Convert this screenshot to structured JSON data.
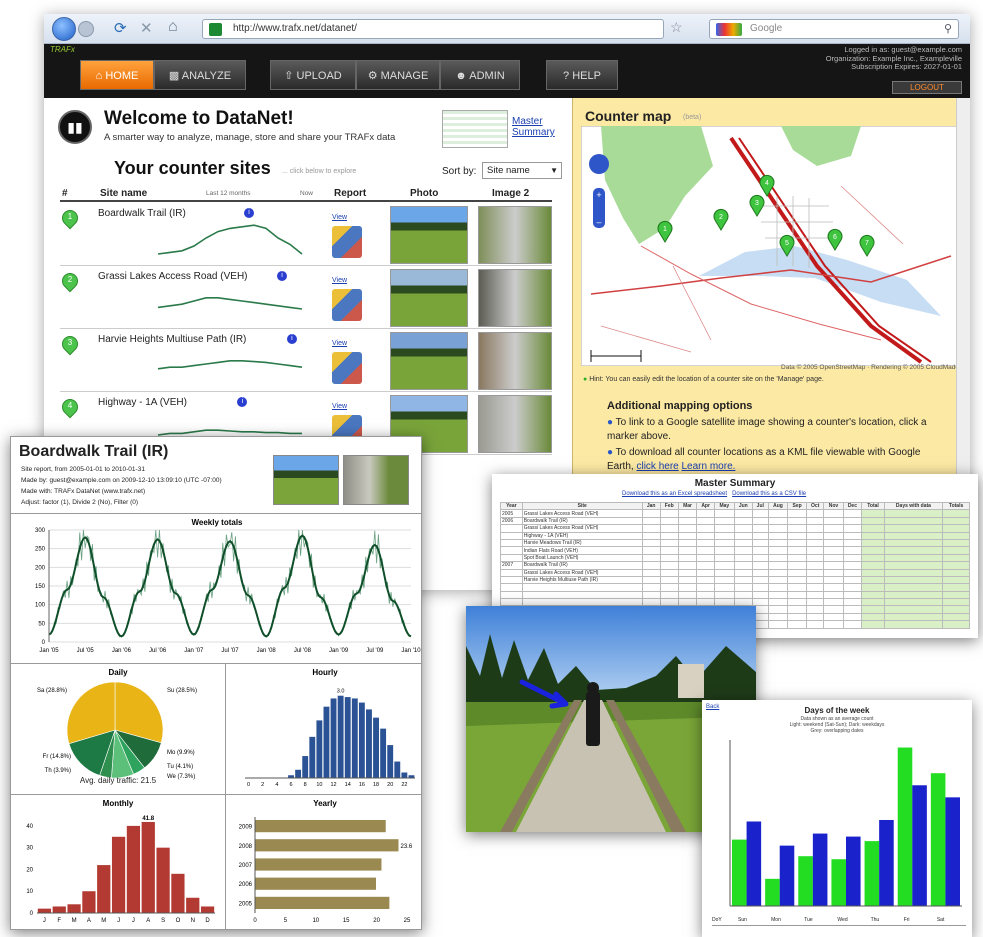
{
  "browser": {
    "url": "http://www.trafx.net/datanet/",
    "search_placeholder": "Google",
    "tab": "TRAFx"
  },
  "nav": {
    "home": "HOME",
    "analyze": "ANALYZE",
    "upload": "UPLOAD",
    "manage": "MANAGE",
    "admin": "ADMIN",
    "help": "HELP"
  },
  "account": {
    "logged_in": "Logged in as: guest@example.com",
    "organization": "Organization: Example Inc., Exampleville",
    "expires": "Subscription Expires: 2027-01-01",
    "logout": "LOGOUT"
  },
  "welcome": {
    "title": "Welcome to DataNet!",
    "subtitle": "A smarter way to analyze, manage, store and share your TRAFx data",
    "master_summary_link": "Master Summary"
  },
  "sites": {
    "title": "Your counter sites",
    "hint": "... click below to explore",
    "sort_label": "Sort by:",
    "sort_value": "Site name",
    "headers": {
      "num": "#",
      "name": "Site name",
      "last12": "Last 12 months",
      "now": "Now",
      "report": "Report",
      "photo": "Photo",
      "image2": "Image 2"
    },
    "view_label": "View",
    "rows": [
      {
        "num": "1",
        "name": "Boardwalk Trail (IR)"
      },
      {
        "num": "2",
        "name": "Grassi Lakes Access Road (VEH)"
      },
      {
        "num": "3",
        "name": "Harvie Heights Multiuse Path (IR)"
      },
      {
        "num": "4",
        "name": "Highway - 1A (VEH)"
      }
    ]
  },
  "map": {
    "title": "Counter map",
    "beta": "(beta)",
    "attribution": "Data © 2005 OpenStreetMap · Rendering © 2005 CloudMade",
    "hint": "Hint: You can easily edit the location of a counter site on the 'Manage' page.",
    "markers": [
      "1",
      "2",
      "3",
      "4",
      "5",
      "6",
      "7"
    ],
    "options_title": "Additional mapping options",
    "option1": "To link to a Google satellite image showing a counter's location, click a marker above.",
    "option2": "To download all counter locations as a KML file viewable with Google Earth,",
    "click_here": "click here",
    "learn_more": "Learn more."
  },
  "report": {
    "title": "Boardwalk Trail (IR)",
    "line1": "Site report, from 2005-01-01 to 2010-01-31",
    "line2": "Made by: guest@example.com on 2009-12-10 13:09:10 (UTC -07:00)",
    "line3": "Made with: TRAFx DataNet (www.trafx.net)",
    "line4": "Adjust: factor (1), Divide 2 (No), Filter (0)",
    "avg_daily": "Avg. daily traffic: 21.5"
  },
  "master": {
    "title": "Master Summary",
    "link1": "Download this as an Excel spreadsheet",
    "link2": "Download this as a CSV file",
    "headers": [
      "Year",
      "Site",
      "Jan",
      "Feb",
      "Mar",
      "Apr",
      "May",
      "Jun",
      "Jul",
      "Aug",
      "Sep",
      "Oct",
      "Nov",
      "Dec",
      "Total",
      "Days with data",
      "Totals"
    ],
    "years": [
      "2005",
      "2006",
      "2007"
    ],
    "sites": [
      "Grassi Lakes Access Road (VEH)",
      "Boardwalk Trail (IR)",
      "Grassi Lakes Access Road (VEH)",
      "Highway - 1A (VEH)",
      "Harvie Meadows Trail (IR)",
      "Indian Flats Road (VEH)",
      "Spot Boat Launch (VEH)",
      "Boardwalk Trail (IR)",
      "Grassi Lakes Access Road (VEH)",
      "Harvie Heights Multiuse Path (IR)"
    ]
  },
  "dow": {
    "title": "Days of the week",
    "back": "Back",
    "subtitle1": "Data shown as an average count",
    "subtitle2": "Light: weekend (Sat-Sun); Dark: weekdays",
    "subtitle3": "Grey: overlapping dates",
    "header": [
      "DoY",
      "Sun",
      "Mon",
      "Tue",
      "Wed",
      "Thu",
      "Fri",
      "Sat"
    ]
  },
  "chart_data": [
    {
      "type": "line",
      "title": "Weekly totals",
      "xlabel": "",
      "ylabel": "",
      "ylim": [
        0,
        300
      ],
      "x_ticks": [
        "Jan '05",
        "Jul '05",
        "Jan '06",
        "Jul '06",
        "Jan '07",
        "Jul '07",
        "Jan '08",
        "Jul '08",
        "Jan '09",
        "Jul '09",
        "Jan '10"
      ],
      "y_ticks": [
        0,
        50,
        100,
        150,
        200,
        250,
        300
      ],
      "series": [
        {
          "x": [
            "2005-01",
            "2005-04",
            "2005-07",
            "2005-10",
            "2006-01",
            "2006-04",
            "2006-07",
            "2006-10",
            "2007-01",
            "2007-04",
            "2007-07",
            "2007-10",
            "2008-01",
            "2008-04",
            "2008-07",
            "2008-10",
            "2009-01",
            "2009-04",
            "2009-07",
            "2009-10",
            "2010-01"
          ],
          "values": [
            20,
            140,
            280,
            120,
            15,
            135,
            275,
            130,
            20,
            140,
            270,
            125,
            15,
            145,
            285,
            120,
            20,
            130,
            260,
            110,
            15
          ]
        }
      ]
    },
    {
      "type": "pie",
      "title": "Daily",
      "slices": [
        {
          "label": "Su (28.5%)",
          "value": 28.5
        },
        {
          "label": "Mo (9.9%)",
          "value": 9.9
        },
        {
          "label": "Tu (4.1%)",
          "value": 4.1
        },
        {
          "label": "We (7.3%)",
          "value": 7.3
        },
        {
          "label": "Th (3.9%)",
          "value": 3.9
        },
        {
          "label": "Fr (14.8%)",
          "value": 14.8
        },
        {
          "label": "Sa (28.8%)",
          "value": 28.8
        }
      ],
      "colors": [
        "#e8b416",
        "#1f6b3a",
        "#2ea35d",
        "#5cc07a",
        "#2f8f4f",
        "#1e7a44",
        "#e8b416"
      ]
    },
    {
      "type": "bar",
      "title": "Hourly",
      "categories": [
        "0",
        "1",
        "2",
        "3",
        "4",
        "5",
        "6",
        "7",
        "8",
        "9",
        "10",
        "11",
        "12",
        "13",
        "14",
        "15",
        "16",
        "17",
        "18",
        "19",
        "20",
        "21",
        "22",
        "23"
      ],
      "values": [
        0,
        0,
        0,
        0,
        0,
        0,
        0.1,
        0.3,
        0.8,
        1.5,
        2.1,
        2.6,
        2.9,
        3.0,
        2.95,
        2.9,
        2.75,
        2.5,
        2.2,
        1.8,
        1.2,
        0.6,
        0.2,
        0.1
      ],
      "ylim": [
        0,
        3.5
      ],
      "peak_label": "3.0",
      "x_ticks": [
        "0",
        "2",
        "4",
        "6",
        "8",
        "10",
        "12",
        "14",
        "16",
        "18",
        "20",
        "22"
      ]
    },
    {
      "type": "bar",
      "title": "Monthly",
      "categories": [
        "J",
        "F",
        "M",
        "A",
        "M",
        "J",
        "J",
        "A",
        "S",
        "O",
        "N",
        "D"
      ],
      "values": [
        2,
        3,
        4,
        10,
        22,
        35,
        40,
        41.8,
        30,
        18,
        7,
        3
      ],
      "ylim": [
        0,
        45
      ],
      "y_ticks": [
        0,
        10,
        20,
        30,
        40
      ],
      "peak_label": "41.8"
    },
    {
      "type": "bar",
      "orientation": "horizontal",
      "title": "Yearly",
      "categories": [
        "2009",
        "2008",
        "2007",
        "2006",
        "2005"
      ],
      "values": [
        21.5,
        23.6,
        20.8,
        19.9,
        22.1
      ],
      "xlim": [
        0,
        25
      ],
      "x_ticks": [
        0,
        5,
        10,
        15,
        20,
        25
      ],
      "peak_label": "23.6"
    },
    {
      "type": "bar",
      "title": "Days of the week",
      "categories": [
        "Sun",
        "Mon",
        "Tue",
        "Wed",
        "Thu",
        "Fri",
        "Sat"
      ],
      "series": [
        {
          "name": "weekend",
          "values": [
            44,
            18,
            33,
            31,
            43,
            105,
            88
          ]
        },
        {
          "name": "weekdays",
          "values": [
            56,
            40,
            48,
            46,
            57,
            80,
            72
          ]
        }
      ],
      "colors": [
        "#22dd22",
        "#1a22cc"
      ]
    }
  ]
}
